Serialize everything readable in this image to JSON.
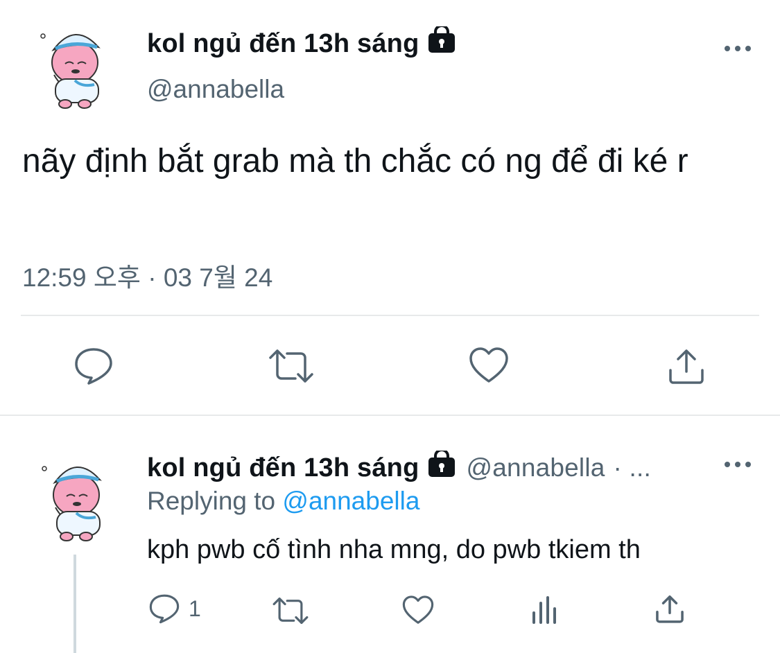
{
  "main_tweet": {
    "author_name": "kol ngủ đến 13h sáng",
    "author_handle": "@annabella",
    "avatar_icon": "sleepy-pink-character-avatar-icon",
    "protected_icon": "lock-icon",
    "text": "nãy định bắt grab mà th chắc có ng để đi ké r",
    "timestamp": "12:59 오후 · 03 7월 24",
    "actions": [
      "reply-icon",
      "retweet-icon",
      "like-icon",
      "share-icon"
    ]
  },
  "reply_tweet": {
    "author_name": "kol ngủ đến 13h sáng",
    "author_handle": "@annabella",
    "meta_suffix": "· ...",
    "replying_label": "Replying to",
    "replying_to": "@annabella",
    "text": "kph pwb cố tình nha mng, do pwb tkiem th",
    "reply_count": "1",
    "actions": [
      "reply-icon",
      "retweet-icon",
      "like-icon",
      "analytics-icon",
      "share-icon"
    ]
  },
  "colors": {
    "text_primary": "#0f1419",
    "text_secondary": "#536471",
    "link": "#1d9bf0",
    "divider": "#e7e9ea"
  }
}
